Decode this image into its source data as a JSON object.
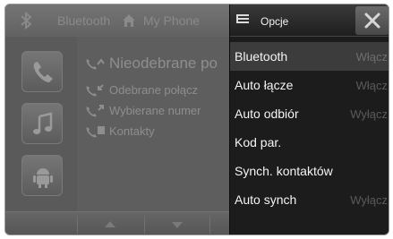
{
  "header": {
    "bluetooth_label": "Bluetooth",
    "phone_label": "My Phone",
    "icons": [
      "bluetooth-icon",
      "home-icon"
    ]
  },
  "sidebar": {
    "items": [
      {
        "name": "phone-app",
        "icon": "phone-handset-icon"
      },
      {
        "name": "music-app",
        "icon": "music-note-icon"
      },
      {
        "name": "android-app",
        "icon": "android-icon"
      }
    ]
  },
  "call_list": {
    "items": [
      {
        "label": "Nieodebrane po",
        "icon": "missed-call-icon"
      },
      {
        "label": "Odebrane połącz",
        "icon": "received-call-icon"
      },
      {
        "label": "Wybierane numer",
        "icon": "dialed-call-icon"
      },
      {
        "label": "Kontakty",
        "icon": "contacts-icon"
      }
    ]
  },
  "popup": {
    "title": "Opcje",
    "options": [
      {
        "label": "Bluetooth",
        "value": "Włącz",
        "selected": true
      },
      {
        "label": "Auto łącze",
        "value": "Włącz",
        "selected": false
      },
      {
        "label": "Auto odbiór",
        "value": "Wyłącz",
        "selected": false
      },
      {
        "label": "Kod par.",
        "value": "",
        "selected": false
      },
      {
        "label": "Synch. kontaktów",
        "value": "",
        "selected": false
      },
      {
        "label": "Auto synch",
        "value": "Wyłącz",
        "selected": false
      }
    ]
  },
  "colors": {
    "popup_bg": "#1c1c1c",
    "selected_row": "#3c3c3c",
    "dim_text": "#8e8e8e",
    "value_text": "#5a5a5a"
  }
}
